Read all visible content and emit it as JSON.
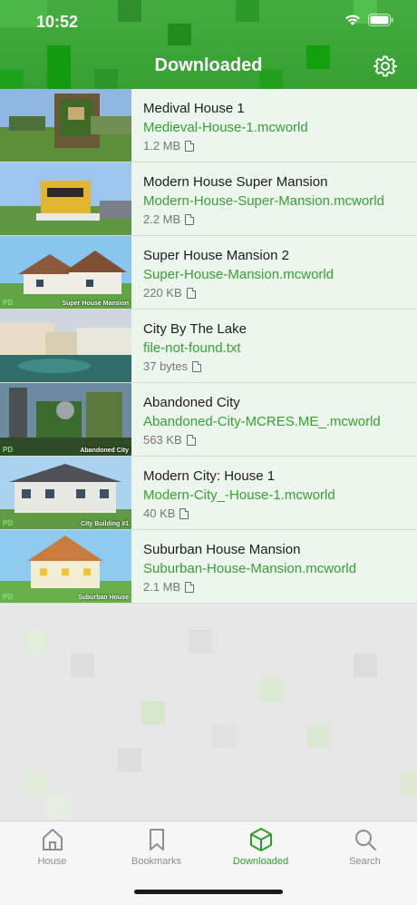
{
  "status_bar": {
    "time": "10:52"
  },
  "header": {
    "title": "Downloaded"
  },
  "items": [
    {
      "name": "Medival House 1",
      "file": "Medieval-House-1.mcworld",
      "size": "1.2 MB",
      "caption": "",
      "badge": ""
    },
    {
      "name": "Modern House Super Mansion",
      "file": "Modern-House-Super-Mansion.mcworld",
      "size": "2.2 MB",
      "caption": "",
      "badge": ""
    },
    {
      "name": "Super House Mansion 2",
      "file": "Super-House-Mansion.mcworld",
      "size": "220 KB",
      "caption": "Super House Mansion",
      "badge": "PD"
    },
    {
      "name": "City By The Lake",
      "file": "file-not-found.txt",
      "size": "37 bytes",
      "caption": "",
      "badge": ""
    },
    {
      "name": "Abandoned City",
      "file": "Abandoned-City-MCRES.ME_.mcworld",
      "size": "563 KB",
      "caption": "Abandoned City",
      "badge": "PD"
    },
    {
      "name": "Modern City: House 1",
      "file": "Modern-City_-House-1.mcworld",
      "size": "40 KB",
      "caption": "City Building #1",
      "badge": "PD"
    },
    {
      "name": "Suburban House Mansion",
      "file": "Suburban-House-Mansion.mcworld",
      "size": "2.1 MB",
      "caption": "Suburban House",
      "badge": "PD"
    }
  ],
  "tabs": [
    {
      "label": "House",
      "icon": "house-icon",
      "active": false
    },
    {
      "label": "Bookmarks",
      "icon": "bookmark-icon",
      "active": false
    },
    {
      "label": "Downloaded",
      "icon": "cube-icon",
      "active": true
    },
    {
      "label": "Search",
      "icon": "search-icon",
      "active": false
    }
  ],
  "colors": {
    "accent": "#2f9e2d",
    "header_green": "#3ea63a",
    "row_bg": "#edf6ec"
  }
}
